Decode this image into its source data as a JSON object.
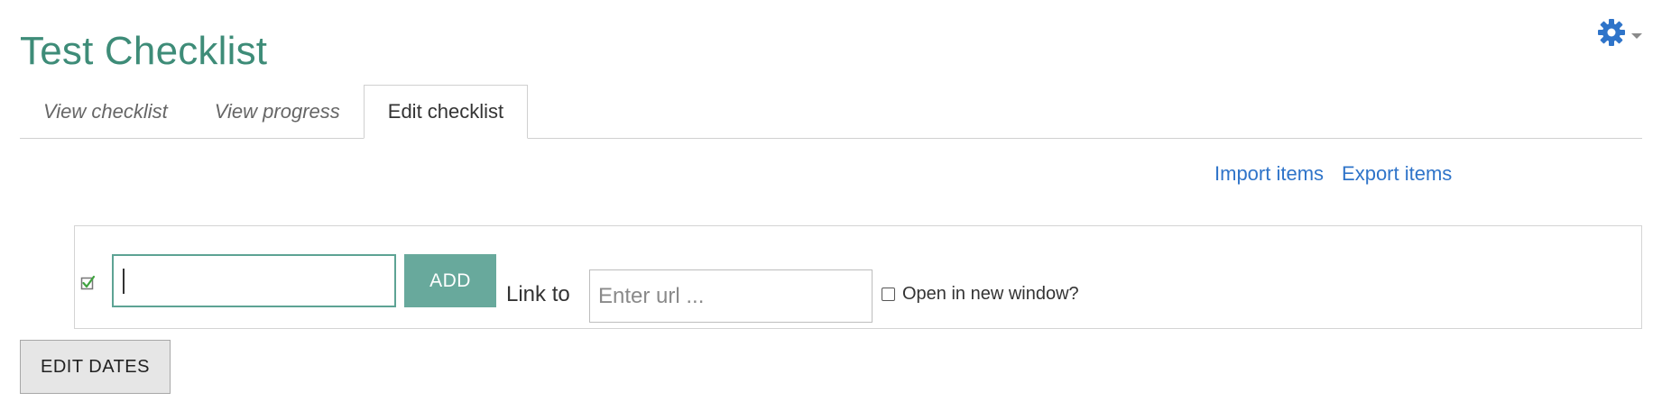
{
  "page": {
    "title": "Test Checklist"
  },
  "settings": {
    "icon": "gear-icon",
    "color": "#2f74c9"
  },
  "tabs": [
    {
      "label": "View checklist",
      "active": false
    },
    {
      "label": "View progress",
      "active": false
    },
    {
      "label": "Edit checklist",
      "active": true
    }
  ],
  "links": {
    "import": "Import items",
    "export": "Export items"
  },
  "add_form": {
    "item_value": "",
    "add_label": "ADD",
    "link_label": "Link to",
    "url_placeholder": "Enter url ...",
    "new_window_label": "Open in new window?",
    "new_window_checked": false
  },
  "edit_dates_label": "EDIT DATES",
  "colors": {
    "accent": "#3e8c78",
    "button": "#68a99c",
    "link": "#2f74c9"
  }
}
